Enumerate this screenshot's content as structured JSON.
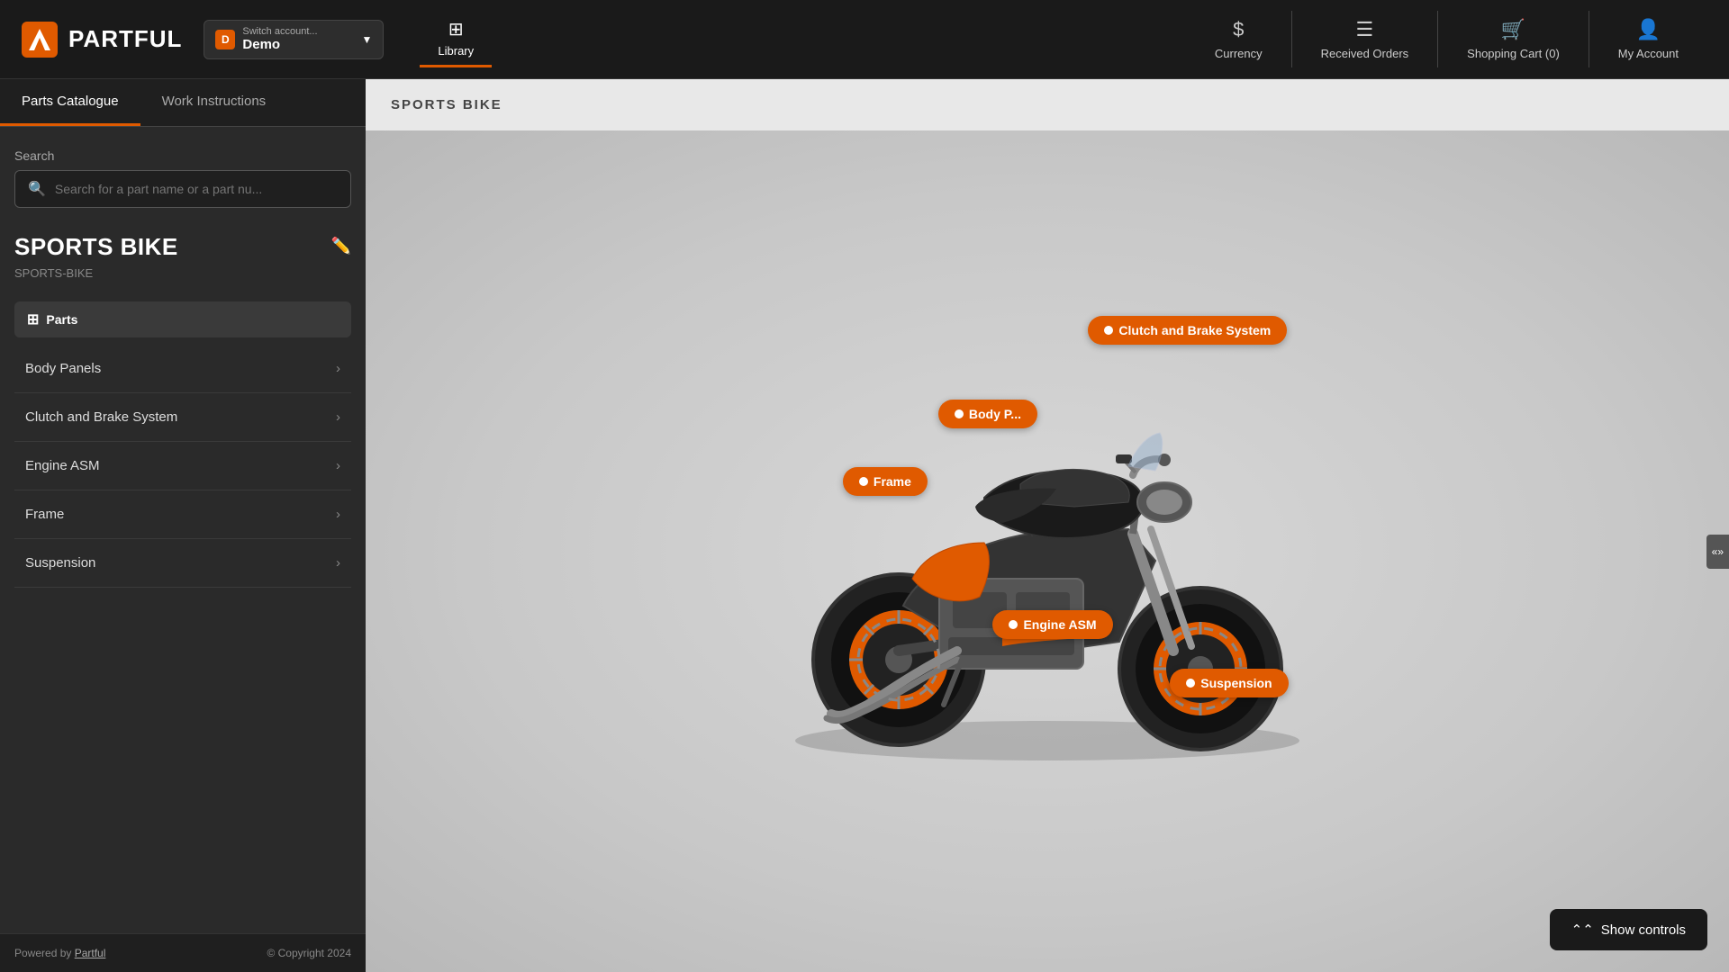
{
  "app": {
    "logo_text": "PARTFUL",
    "logo_icon": "P"
  },
  "top_nav": {
    "account_switcher_label": "Switch account...",
    "account_name": "Demo",
    "account_initial": "D",
    "library_label": "Library",
    "currency_label": "Currency",
    "received_orders_label": "Received Orders",
    "shopping_cart_label": "Shopping Cart (0)",
    "my_account_label": "My Account"
  },
  "sidebar": {
    "tab_parts": "Parts Catalogue",
    "tab_work_instructions": "Work Instructions",
    "search_label": "Search",
    "search_placeholder": "Search for a part name or a part nu...",
    "product_title": "SPORTS BIKE",
    "product_code": "SPORTS-BIKE",
    "parts_header": "Parts",
    "parts_items": [
      {
        "label": "Body Panels"
      },
      {
        "label": "Clutch and Brake System"
      },
      {
        "label": "Engine ASM"
      },
      {
        "label": "Frame"
      },
      {
        "label": "Suspension"
      }
    ],
    "footer_powered": "Powered by ",
    "footer_brand": "Partful",
    "footer_copyright": "© Copyright 2024"
  },
  "main": {
    "title": "SPORTS BIKE",
    "hotspots": [
      {
        "label": "Clutch and Brake System",
        "class": "hotspot-clutch"
      },
      {
        "label": "Body P...",
        "class": "hotspot-body"
      },
      {
        "label": "Frame",
        "class": "hotspot-frame"
      },
      {
        "label": "Engine ASM",
        "class": "hotspot-engine"
      },
      {
        "label": "Suspension",
        "class": "hotspot-suspension"
      }
    ],
    "show_controls_label": "Show controls"
  }
}
